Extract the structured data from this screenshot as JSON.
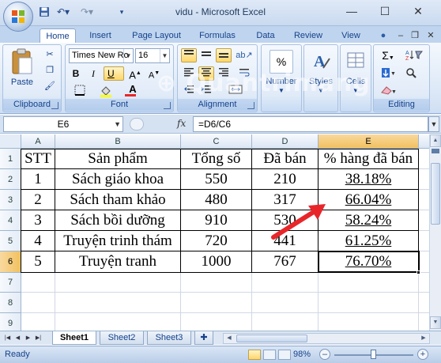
{
  "window": {
    "title": "vidu - Microsoft Excel",
    "controls": {
      "minimize": "—",
      "maximize": "☐",
      "close": "✕"
    }
  },
  "qat": [
    "save-icon",
    "undo-icon",
    "redo-icon",
    "customize-icon"
  ],
  "tabs": [
    "Home",
    "Insert",
    "Page Layout",
    "Formulas",
    "Data",
    "Review",
    "View"
  ],
  "active_tab": "Home",
  "ribbon": {
    "clipboard": {
      "label": "Clipboard",
      "paste": "Paste"
    },
    "font": {
      "label": "Font",
      "font_name": "Times New Ro",
      "font_size": "16",
      "bold": "B",
      "italic": "I",
      "underline": "U"
    },
    "alignment": {
      "label": "Alignment"
    },
    "number": {
      "label": "Number",
      "percent": "%"
    },
    "styles": {
      "label": "Styles"
    },
    "cells": {
      "label": "Cells"
    },
    "editing": {
      "label": "Editing",
      "sum": "Σ"
    }
  },
  "formula_bar": {
    "name_box": "E6",
    "fx": "fx",
    "formula": "=D6/C6"
  },
  "grid": {
    "columns": [
      "A",
      "B",
      "C",
      "D",
      "E"
    ],
    "rows": [
      "1",
      "2",
      "3",
      "4",
      "5",
      "6",
      "7",
      "8",
      "9"
    ],
    "selected_cell": "E6",
    "header": [
      "STT",
      "Sản phẩm",
      "Tổng số",
      "Đã bán",
      "% hàng đã bán"
    ],
    "data": [
      [
        "1",
        "Sách giáo khoa",
        "550",
        "210",
        "38.18%"
      ],
      [
        "2",
        "Sách tham khảo",
        "480",
        "317",
        "66.04%"
      ],
      [
        "3",
        "Sách bồi dưỡng",
        "910",
        "530",
        "58.24%"
      ],
      [
        "4",
        "Truyện trinh thám",
        "720",
        "441",
        "61.25%"
      ],
      [
        "5",
        "Truyện tranh",
        "1000",
        "767",
        "76.70%"
      ]
    ]
  },
  "annotation": {
    "arrow_color": "#e8262a"
  },
  "sheets": [
    "Sheet1",
    "Sheet2",
    "Sheet3"
  ],
  "active_sheet": "Sheet1",
  "status": {
    "text": "Ready",
    "zoom": "98%",
    "zoom_value": 0.98
  },
  "colors": {
    "accent": "#15428b",
    "selection": "#f1c15f"
  }
}
